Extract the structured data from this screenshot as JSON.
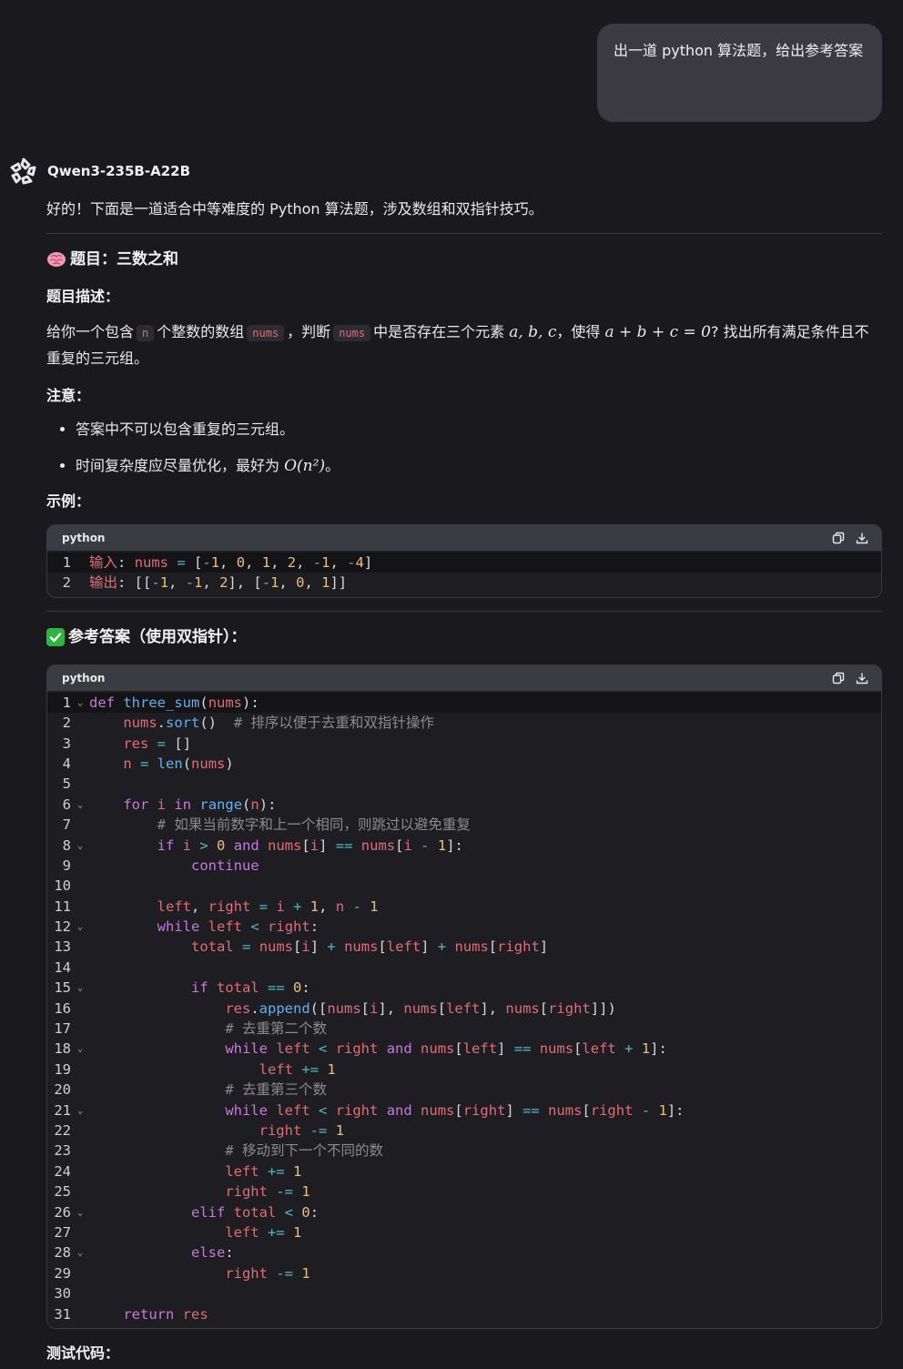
{
  "user_message": "出一道 python 算法题，给出参考答案",
  "assistant": {
    "model_name": "Qwen3-235B-A22B",
    "intro": "好的！下面是一道适合中等难度的 Python 算法题，涉及数组和双指针技巧。",
    "problem_title": "题目：三数之和",
    "desc_label": "题目描述：",
    "desc_part1": "给你一个包含",
    "desc_code_n": "n",
    "desc_part2": "个整数的数组",
    "desc_code_nums1": "nums",
    "desc_part3": "，判断",
    "desc_code_nums2": "nums",
    "desc_part4": "中是否存在三个元素",
    "desc_math1": "a, b, c",
    "desc_part5": "，使得",
    "desc_math2": "a + b + c = 0",
    "desc_part6": "? 找出所有满足条件且不重复的三元组。",
    "notes_label": "注意：",
    "note1": "答案中不可以包含重复的三元组。",
    "note2_text": "时间复杂度应尽量优化，最好为",
    "note2_math": "O(n²)",
    "note2_end": "。",
    "example_label": "示例：",
    "answer_title": "参考答案（使用双指针）：",
    "test_label": "测试代码：",
    "example_code": {
      "lang": "python",
      "lines": [
        [
          "1",
          "输入: nums = [-1, 0, 1, 2, -1, -4]"
        ],
        [
          "2",
          "输出: [[-1, -1, 2], [-1, 0, 1]]"
        ]
      ]
    },
    "answer_code": {
      "lang": "python",
      "lines": [
        "def three_sum(nums):",
        "    nums.sort()  # 排序以便于去重和双指针操作",
        "    res = []",
        "    n = len(nums)",
        "",
        "    for i in range(n):",
        "        # 如果当前数字和上一个相同，则跳过以避免重复",
        "        if i > 0 and nums[i] == nums[i - 1]:",
        "            continue",
        "",
        "        left, right = i + 1, n - 1",
        "        while left < right:",
        "            total = nums[i] + nums[left] + nums[right]",
        "",
        "            if total == 0:",
        "                res.append([nums[i], nums[left], nums[right]])",
        "                # 去重第二个数",
        "                while left < right and nums[left] == nums[left + 1]:",
        "                    left += 1",
        "                # 去重第三个数",
        "                while left < right and nums[right] == nums[right - 1]:",
        "                    right -= 1",
        "                # 移动到下一个不同的数",
        "                left += 1",
        "                right -= 1",
        "            elif total < 0:",
        "                left += 1",
        "            else:",
        "                right -= 1",
        "",
        "    return res"
      ],
      "foldable_lines": [
        1,
        6,
        8,
        12,
        15,
        18,
        21,
        26,
        28
      ]
    }
  },
  "icons": {
    "copy": "copy-icon",
    "download": "download-icon",
    "brain": "brain-icon",
    "check": "check-icon"
  },
  "colors": {
    "background": "#1a1a1e",
    "user_bubble": "#3a3a40",
    "code_header": "#3b3c42",
    "keyword": "#c678dd",
    "function": "#61afef",
    "variable": "#e06c75",
    "number": "#e5c07b",
    "operator": "#56b6c2",
    "comment": "#8b8b8b"
  }
}
